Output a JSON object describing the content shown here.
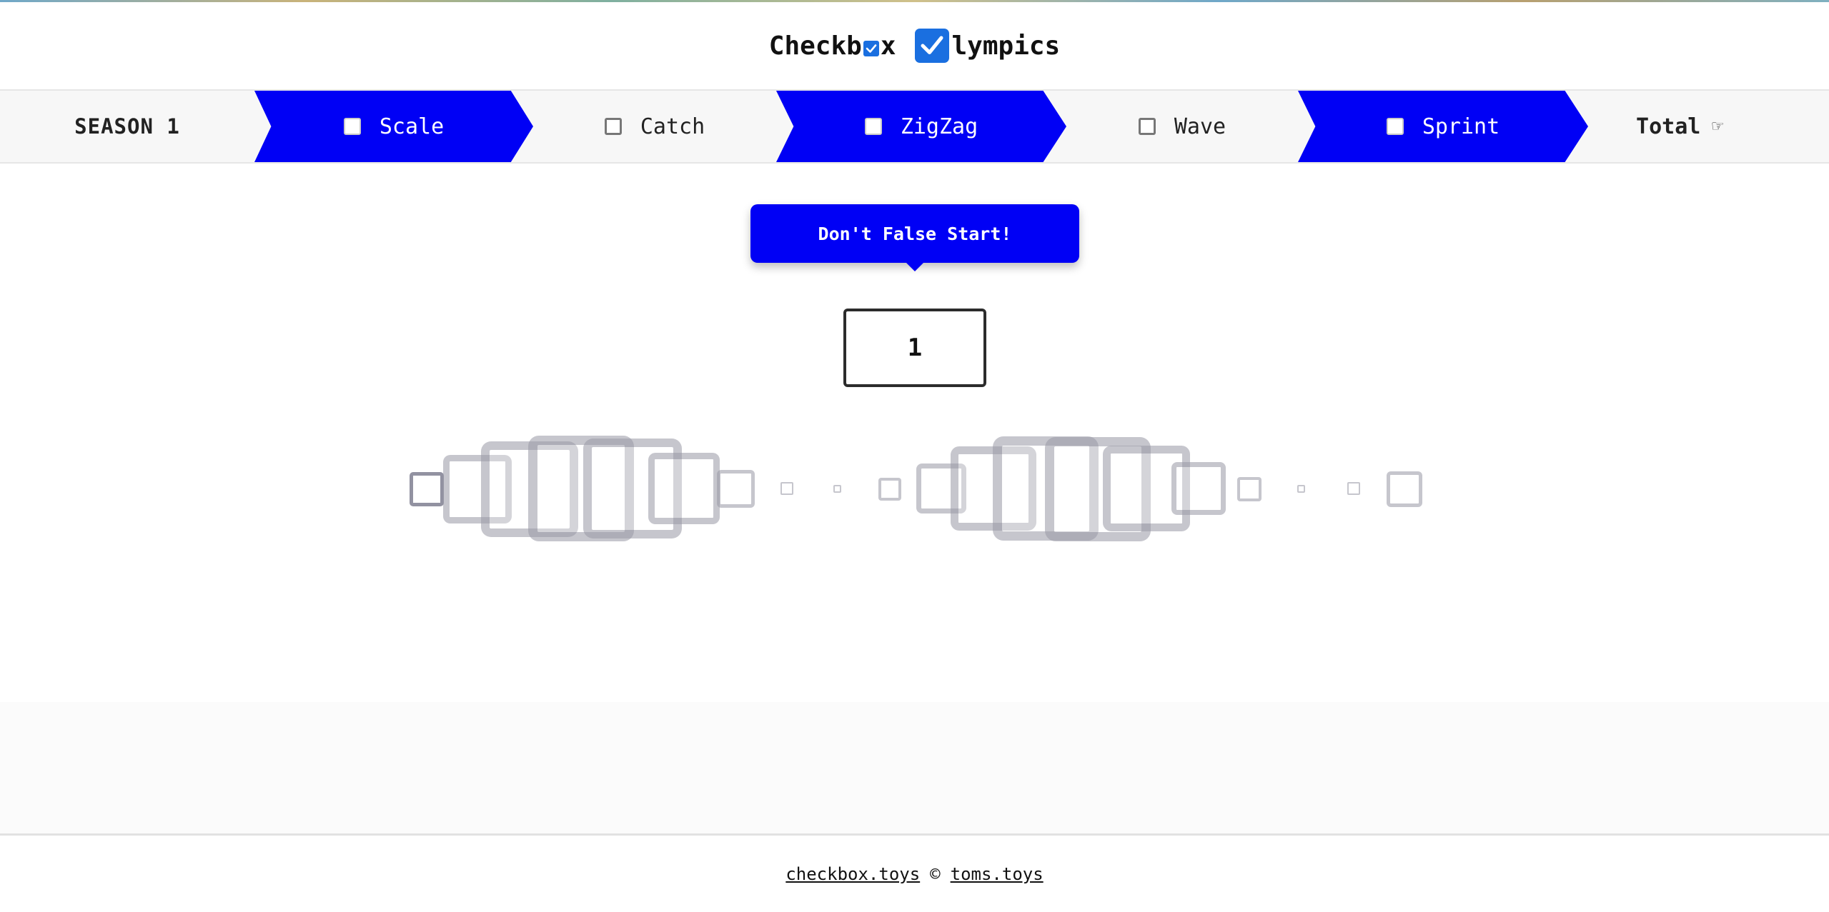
{
  "header": {
    "logo_part1": "Checkb",
    "logo_part2": "x",
    "logo_part3": "lympics"
  },
  "nav": {
    "season_label": "SEASON 1",
    "tabs": [
      {
        "label": "Scale",
        "style": "blue",
        "checked": false
      },
      {
        "label": "Catch",
        "style": "plain",
        "checked": false
      },
      {
        "label": "ZigZag",
        "style": "blue",
        "checked": false
      },
      {
        "label": "Wave",
        "style": "plain",
        "checked": false
      },
      {
        "label": "Sprint",
        "style": "blue",
        "checked": false
      }
    ],
    "total_label": "Total",
    "total_icon": "pointing-hand-icon",
    "total_glyph": "☞"
  },
  "game": {
    "tooltip": "Don't False Start!",
    "counter": "1"
  },
  "footer": {
    "link1": "checkbox.toys",
    "separator": "©",
    "link2": "toms.toys"
  },
  "colors": {
    "accent_blue": "#0000f5",
    "logo_blue": "#1a6fe0",
    "nav_background": "#f7f7f7"
  }
}
